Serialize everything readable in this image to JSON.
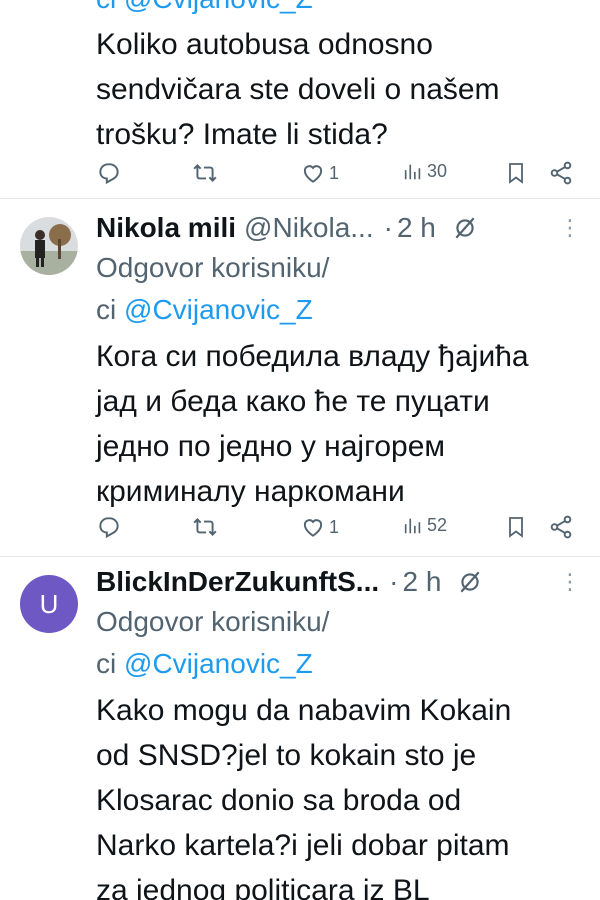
{
  "tweets": [
    {
      "handle_partial": "ci @Cvijanovic_Z",
      "text_lines": [
        "Koliko autobusa odnosno",
        "sendvičara ste doveli o našem",
        "trošku? Imate li stida?"
      ],
      "stats": {
        "replies": "",
        "retweets": "",
        "likes": "1",
        "views": "30"
      }
    },
    {
      "name": "Nikola mili",
      "handle": "@Nikola...",
      "time": "2 h",
      "reply_label": "Odgovor korisniku/",
      "reply_prefix": "ci",
      "reply_mention": "@Cvijanovic_Z",
      "text_lines": [
        "Кога си победила владу ђајића",
        "јад и беда како ће те пуцати",
        "једно по једно у најгорем",
        "криминалу наркомани"
      ],
      "stats": {
        "replies": "",
        "retweets": "",
        "likes": "1",
        "views": "52"
      }
    },
    {
      "name": "BlickInDerZukunftS...",
      "avatar_letter": "U",
      "time": "2 h",
      "reply_label": "Odgovor korisniku/",
      "reply_prefix": "ci",
      "reply_mention": "@Cvijanovic_Z",
      "text_lines": [
        "Kako mogu da nabavim Kokain",
        "od SNSD?jel to kokain sto je",
        "Klosarac donio sa broda od",
        "Narko kartela?i jeli dobar pitam",
        "za jednog politicara iz BL"
      ]
    }
  ],
  "separators": {
    "dot": "·",
    "more": "⋮"
  },
  "colors": {
    "accent": "#1d9bf0",
    "secondary_text": "#536471",
    "avatar_u": "#6e58c4"
  }
}
